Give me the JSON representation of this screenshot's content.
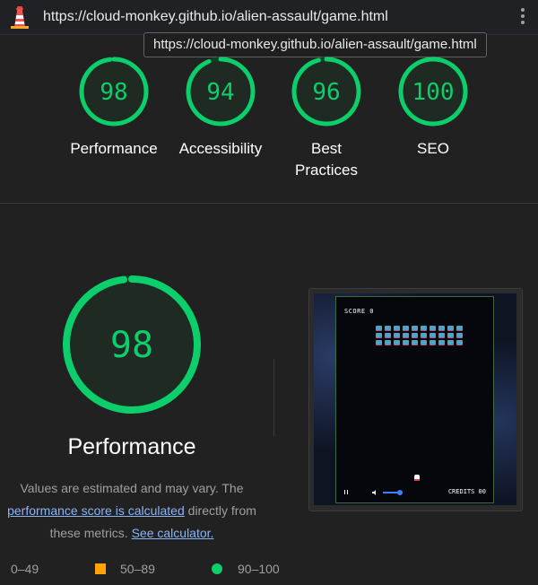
{
  "browser": {
    "url": "https://cloud-monkey.github.io/alien-assault/game.html",
    "tooltip": "https://cloud-monkey.github.io/alien-assault/game.html",
    "icons": {
      "logo": "lighthouse-icon",
      "menu": "kebab-menu-icon"
    }
  },
  "colors": {
    "pass": "#0cce6b",
    "average": "#ffa400",
    "fail": "#ff4e42",
    "background": "#212121"
  },
  "gauges": [
    {
      "score": "98",
      "score_value": 98,
      "label": "Performance"
    },
    {
      "score": "94",
      "score_value": 94,
      "label": "Accessibility"
    },
    {
      "score": "96",
      "score_value": 96,
      "label": "Best Practices",
      "label_line1": "Best",
      "label_line2": "Practices"
    },
    {
      "score": "100",
      "score_value": 100,
      "label": "SEO"
    }
  ],
  "performance": {
    "score": "98",
    "score_value": 98,
    "title": "Performance",
    "note_prefix": "Values are estimated and may vary. The",
    "note_link": "performance score is calculated",
    "note_mid": "directly from these metrics.",
    "note_link2": "See calculator."
  },
  "screenshot": {
    "score_text": "SCORE 0",
    "credits_text": "CREDITS 00"
  },
  "legend": [
    {
      "range": "0–49",
      "shape": "triangle"
    },
    {
      "range": "50–89",
      "shape": "square"
    },
    {
      "range": "90–100",
      "shape": "circle"
    }
  ]
}
